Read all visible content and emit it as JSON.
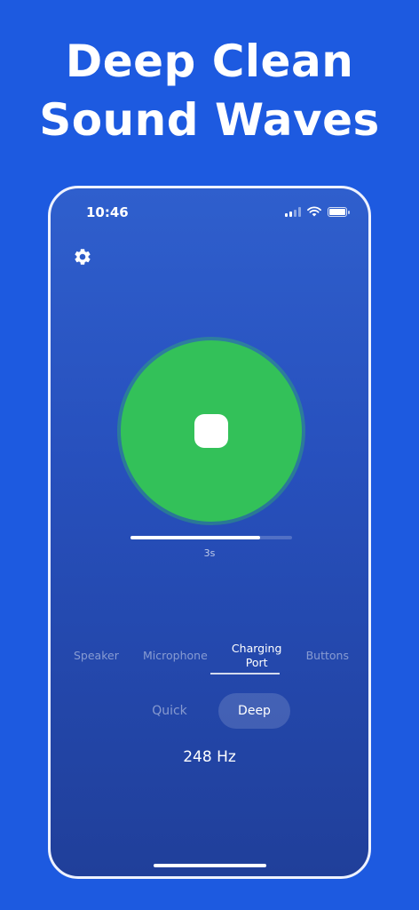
{
  "headline": {
    "line1": "Deep Clean",
    "line2": "Sound Waves"
  },
  "status_bar": {
    "time": "10:46",
    "icons": [
      "signal-icon",
      "wifi-icon",
      "battery-icon"
    ]
  },
  "settings": {
    "icon": "gear-icon"
  },
  "cleaner": {
    "state": "running",
    "button_icon": "stop-icon",
    "button_color": "#33c159",
    "progress_fraction": 0.8,
    "elapsed_label": "3s"
  },
  "targets": [
    {
      "label": "Speaker",
      "active": false
    },
    {
      "label": "Microphone",
      "active": false
    },
    {
      "label": "Charging\nPort",
      "active": true
    },
    {
      "label": "Buttons",
      "active": false
    }
  ],
  "modes": {
    "quick_label": "Quick",
    "deep_label": "Deep",
    "selected": "Deep"
  },
  "frequency": "248 Hz",
  "colors": {
    "background": "#1d5ae0",
    "accent": "#33c159"
  }
}
